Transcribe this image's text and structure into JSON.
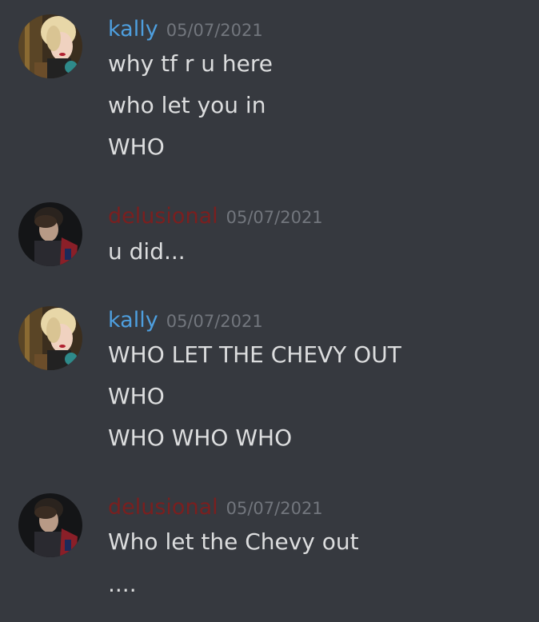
{
  "colors": {
    "background": "#36393f",
    "kally_name": "#4e9fdf",
    "delusional_name": "#7a1f1f",
    "message_text": "#dcddde",
    "timestamp": "#72767d"
  },
  "messages": [
    {
      "username": "kally",
      "timestamp": "05/07/2021",
      "avatar": "kally-avatar",
      "lines": [
        "why tf r u here",
        "who let you in",
        "WHO"
      ]
    },
    {
      "username": "delusional",
      "timestamp": "05/07/2021",
      "avatar": "delusional-avatar",
      "lines": [
        "u did..."
      ]
    },
    {
      "username": "kally",
      "timestamp": "05/07/2021",
      "avatar": "kally-avatar",
      "lines": [
        "WHO LET THE CHEVY OUT",
        "WHO",
        "WHO WHO WHO"
      ]
    },
    {
      "username": "delusional",
      "timestamp": "05/07/2021",
      "avatar": "delusional-avatar",
      "lines": [
        "Who let the Chevy out",
        "...."
      ]
    }
  ]
}
